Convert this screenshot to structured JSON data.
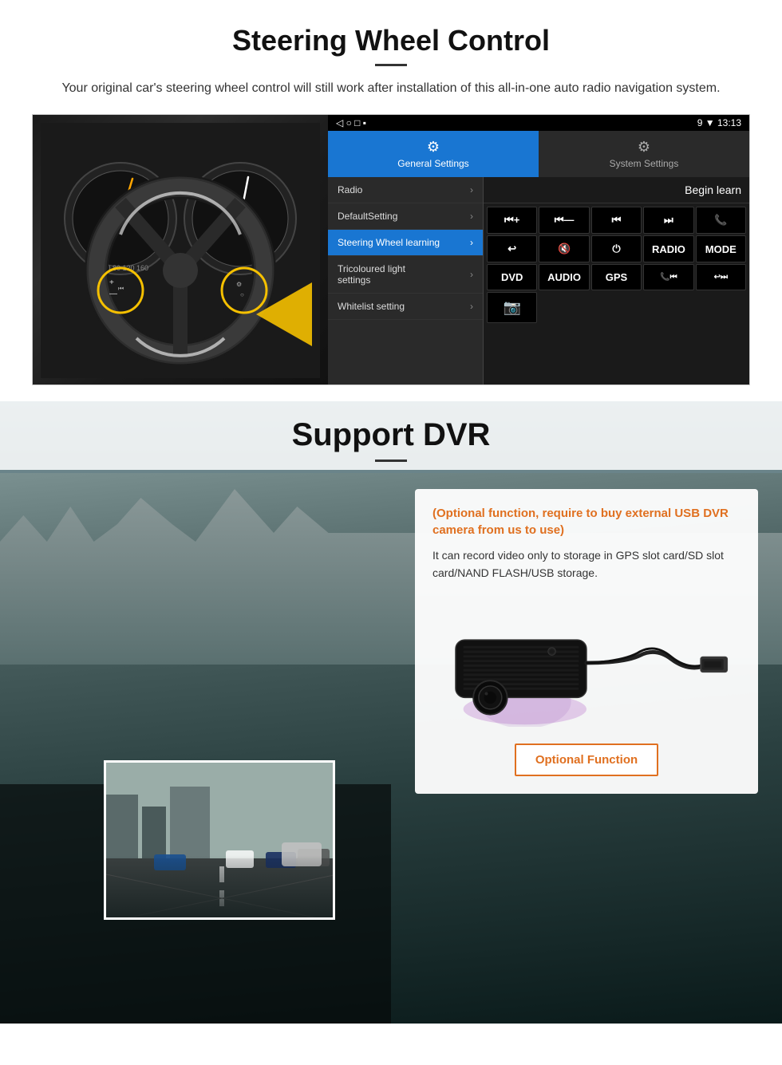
{
  "page": {
    "steering_section": {
      "title": "Steering Wheel Control",
      "subtitle": "Your original car's steering wheel control will still work after installation of this all-in-one auto radio navigation system.",
      "statusbar": {
        "left_icons": "◁  ○  □  ▪",
        "right_text": "9 ▼ 13:13"
      },
      "tabs": [
        {
          "id": "general",
          "label": "General Settings",
          "active": true
        },
        {
          "id": "system",
          "label": "System Settings",
          "active": false
        }
      ],
      "menu_items": [
        {
          "id": "radio",
          "label": "Radio",
          "active": false
        },
        {
          "id": "default",
          "label": "DefaultSetting",
          "active": false
        },
        {
          "id": "steering",
          "label": "Steering Wheel learning",
          "active": true
        },
        {
          "id": "tricolour",
          "label": "Tricoloured light settings",
          "active": false
        },
        {
          "id": "whitelist",
          "label": "Whitelist setting",
          "active": false
        }
      ],
      "begin_learn_label": "Begin learn",
      "control_buttons": [
        "⏮+",
        "⏮—",
        "⏮",
        "⏭",
        "📞",
        "↩",
        "🔇",
        "⏻",
        "RADIO",
        "MODE",
        "DVD",
        "AUDIO",
        "GPS",
        "📞⏮",
        "↩⏭"
      ]
    },
    "dvr_section": {
      "title": "Support DVR",
      "optional_highlight": "(Optional function, require to buy external USB DVR camera from us to use)",
      "description": "It can record video only to storage in GPS slot card/SD slot card/NAND FLASH/USB storage.",
      "optional_function_btn": "Optional Function"
    }
  }
}
